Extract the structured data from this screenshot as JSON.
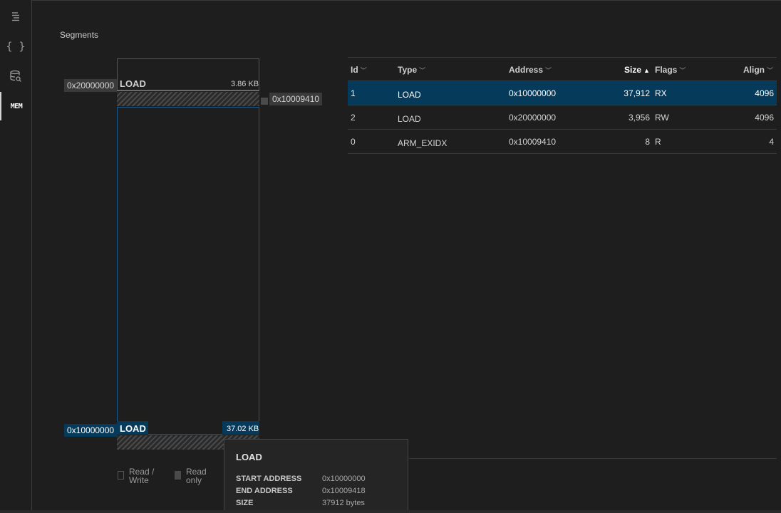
{
  "activity_bar": {
    "items": [
      {
        "icon": "outline-icon"
      },
      {
        "icon": "braces-icon",
        "text": "{ }"
      },
      {
        "icon": "database-search-icon"
      },
      {
        "icon": "memory-icon",
        "text": "MEM",
        "active": true
      }
    ]
  },
  "panel_title": "Segments",
  "memory_map": {
    "ram": {
      "address": "0x20000000",
      "name": "LOAD",
      "size": "3.86 KB"
    },
    "exidx": {
      "address": "0x10009410"
    },
    "flash": {
      "address": "0x10000000",
      "name": "LOAD",
      "size": "37.02 KB"
    }
  },
  "legend": {
    "read_write": "Read / Write",
    "read_only": "Read only"
  },
  "table": {
    "columns": [
      "Id",
      "Type",
      "Address",
      "Size",
      "Flags",
      "Align"
    ],
    "sorted_column": "Size",
    "rows": [
      {
        "id": "1",
        "type": "LOAD",
        "address": "0x10000000",
        "size": "37,912",
        "flags": "RX",
        "align": "4096",
        "selected": true
      },
      {
        "id": "2",
        "type": "LOAD",
        "address": "0x20000000",
        "size": "3,956",
        "flags": "RW",
        "align": "4096"
      },
      {
        "id": "0",
        "type": "ARM_EXIDX",
        "address": "0x10009410",
        "size": "8",
        "flags": "R",
        "align": "4"
      }
    ]
  },
  "tooltip": {
    "title": "LOAD",
    "start_label": "START ADDRESS",
    "start_value": "0x10000000",
    "end_label": "END ADDRESS",
    "end_value": "0x10009418",
    "size_label": "SIZE",
    "size_value": "37912 bytes"
  },
  "colors": {
    "selection": "#063a5a",
    "background": "#1e1e1e",
    "border": "#3a3a3a"
  }
}
